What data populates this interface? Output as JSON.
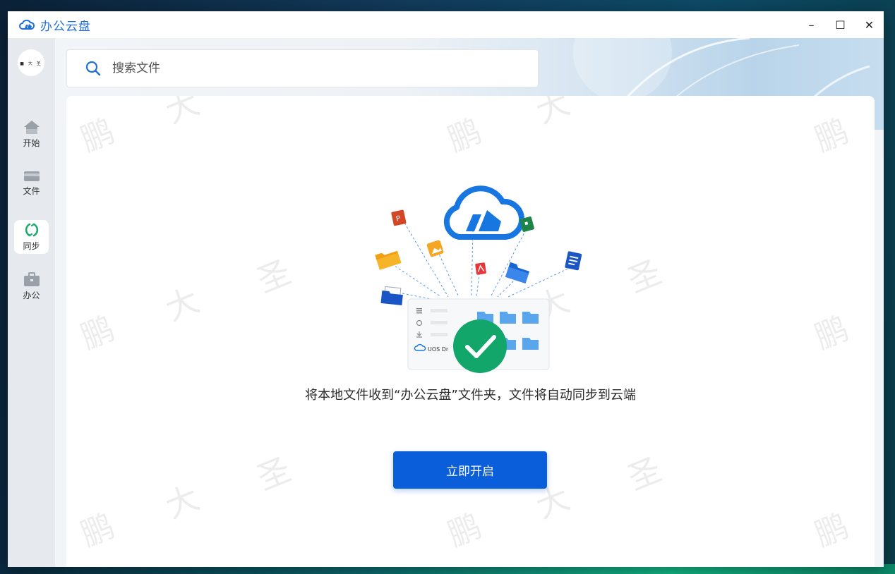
{
  "app": {
    "title": "办公云盘"
  },
  "window_controls": {
    "minimize": "–",
    "maximize": "☐",
    "close": "✕"
  },
  "user": {
    "avatar_text": "■ 大 圣"
  },
  "sidebar": {
    "items": [
      {
        "label": "开始",
        "icon": "home-icon",
        "active": false
      },
      {
        "label": "文件",
        "icon": "folder-icon",
        "active": false
      },
      {
        "label": "同步",
        "icon": "sync-icon",
        "active": true
      },
      {
        "label": "办公",
        "icon": "briefcase-icon",
        "active": false
      }
    ]
  },
  "search": {
    "placeholder": "搜索文件"
  },
  "main": {
    "illustration": {
      "preview_label": "UOS Dr"
    },
    "description": "将本地文件收到“办公云盘”文件夹，文件将自动同步到云端",
    "start_button": "立即开启"
  },
  "watermark": {
    "chars": [
      "鹏",
      "大",
      "圣"
    ]
  },
  "colors": {
    "accent": "#0b5ed9",
    "sync_active": "#1aaa6b",
    "check": "#12a66a",
    "title": "#1f6fd6"
  }
}
